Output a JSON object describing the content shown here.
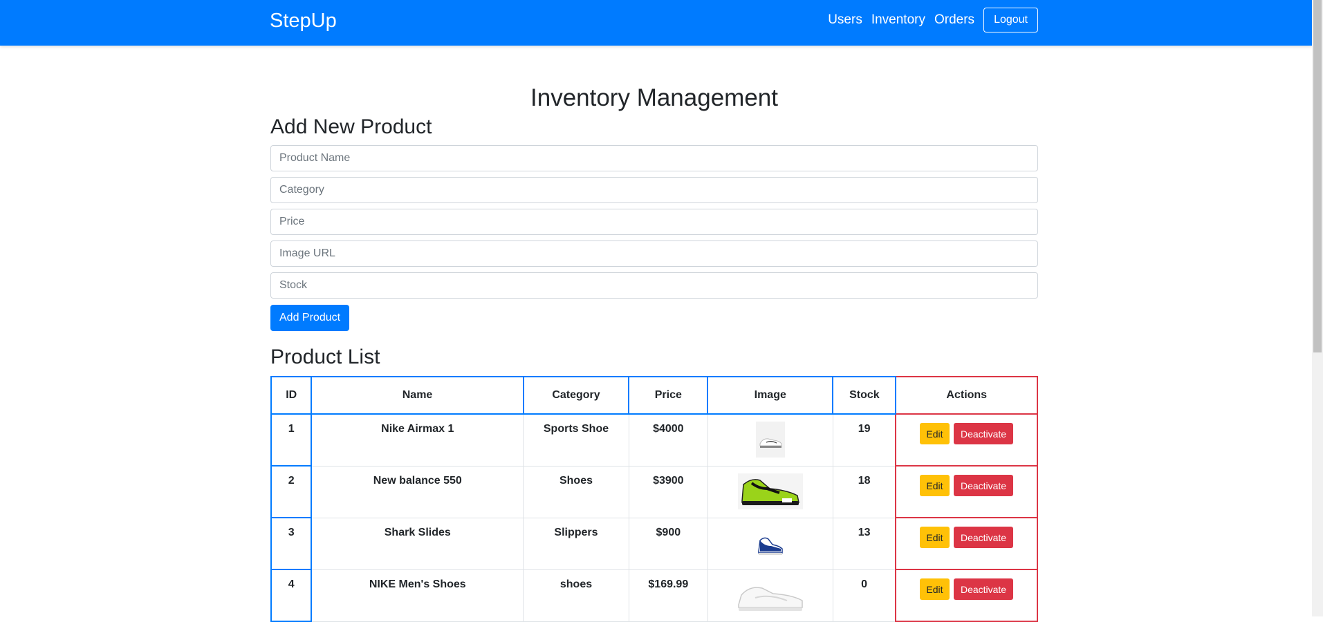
{
  "navbar": {
    "brand": "StepUp",
    "links": [
      "Users",
      "Inventory",
      "Orders"
    ],
    "logout_label": "Logout"
  },
  "page_title": "Inventory Management",
  "add_form": {
    "title": "Add New Product",
    "placeholders": {
      "name": "Product Name",
      "category": "Category",
      "price": "Price",
      "image_url": "Image URL",
      "stock": "Stock"
    },
    "submit_label": "Add Product"
  },
  "product_list": {
    "title": "Product List",
    "columns": [
      "ID",
      "Name",
      "Category",
      "Price",
      "Image",
      "Stock",
      "Actions"
    ],
    "edit_label": "Edit",
    "deactivate_label": "Deactivate",
    "rows": [
      {
        "id": "1",
        "name": "Nike Airmax 1",
        "category": "Sports Shoe",
        "price": "$4000",
        "stock": "19",
        "image": "white-sneaker-icon"
      },
      {
        "id": "2",
        "name": "New balance 550",
        "category": "Shoes",
        "price": "$3900",
        "stock": "18",
        "image": "green-black-sneaker-icon"
      },
      {
        "id": "3",
        "name": "Shark Slides",
        "category": "Slippers",
        "price": "$900",
        "stock": "13",
        "image": "blue-white-sneaker-icon"
      },
      {
        "id": "4",
        "name": "NIKE Men's Shoes",
        "category": "shoes",
        "price": "$169.99",
        "stock": "0",
        "image": "white-low-sneaker-icon"
      }
    ]
  },
  "colors": {
    "primary": "#007bff",
    "danger": "#dc3545",
    "warning": "#ffc107"
  }
}
